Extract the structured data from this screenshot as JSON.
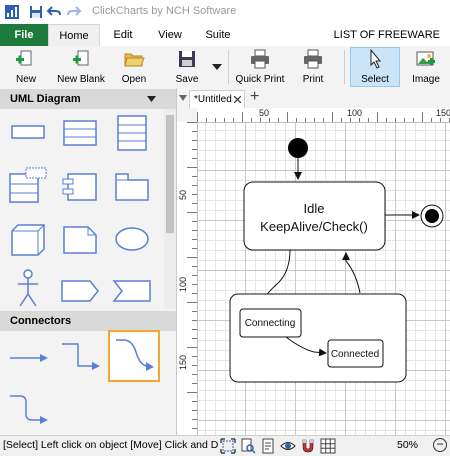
{
  "app": {
    "title": "ClickCharts by NCH Software"
  },
  "tabs": {
    "file": "File",
    "home": "Home",
    "edit": "Edit",
    "view": "View",
    "suite": "Suite",
    "freeware": "LIST OF FREEWARE"
  },
  "ribbon": {
    "new": "New",
    "new_blank": "New Blank",
    "open": "Open",
    "save": "Save",
    "quick_print": "Quick Print",
    "print": "Print",
    "select": "Select",
    "image": "Image"
  },
  "panel": {
    "uml_title": "UML Diagram",
    "connectors_title": "Connectors"
  },
  "doc": {
    "tab_label": "*Untitled",
    "add_tab": "+"
  },
  "rulers": {
    "top": [
      "50",
      "100",
      "150"
    ],
    "left": [
      "50",
      "100",
      "150"
    ]
  },
  "diagram": {
    "state_idle_line1": "Idle",
    "state_idle_line2": "KeepAlive/Check()",
    "state_connecting": "Connecting",
    "state_connected": "Connected"
  },
  "status": {
    "text": "[Select] Left click on object  [Move] Click and Dra",
    "zoom": "50%",
    "zoom_minus": "−"
  },
  "colors": {
    "file_tab": "#1e7a3c",
    "shape_stroke": "#5a7fd6",
    "select_highlight": "#cce4f7",
    "connector_selected": "#f0a830"
  }
}
